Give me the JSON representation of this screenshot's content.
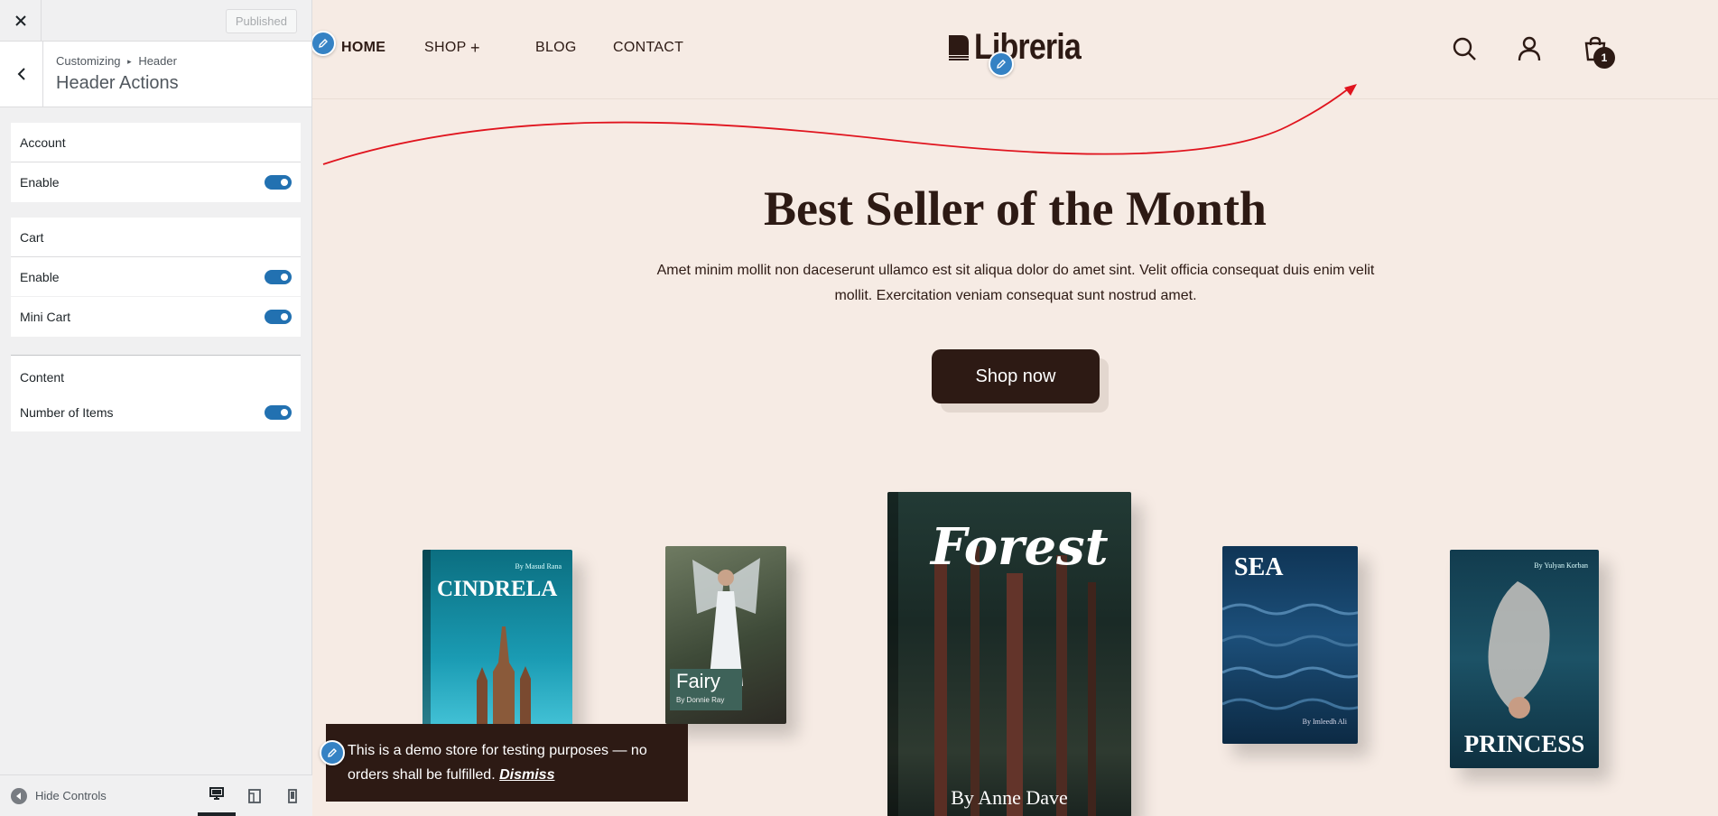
{
  "customizer": {
    "published_label": "Published",
    "breadcrumb": {
      "root": "Customizing",
      "separator": "▸",
      "parent": "Header"
    },
    "section_title": "Header Actions",
    "groups": {
      "account": {
        "title": "Account",
        "rows": [
          {
            "label": "Enable",
            "enabled": true
          }
        ]
      },
      "cart": {
        "title": "Cart",
        "rows": [
          {
            "label": "Enable",
            "enabled": true
          },
          {
            "label": "Mini Cart",
            "enabled": true
          }
        ]
      },
      "content": {
        "title": "Content",
        "rows": [
          {
            "label": "Number of Items",
            "enabled": true
          }
        ]
      }
    },
    "footer": {
      "hide_controls_label": "Hide Controls",
      "devices": [
        "desktop",
        "tablet",
        "mobile"
      ],
      "active_device": "desktop"
    },
    "toggle_color": "#2271b1"
  },
  "site": {
    "nav": {
      "home": "HOME",
      "shop": "SHOP",
      "shop_plus": "+",
      "blog": "BLOG",
      "contact": "CONTACT"
    },
    "logo_text": "Libreria",
    "cart_count": "1",
    "icons": [
      "search-icon",
      "account-icon",
      "cart-icon"
    ],
    "hero": {
      "title": "Best Seller of the Month",
      "text": "Amet minim mollit non daceserunt ullamco est sit aliqua dolor do amet sint. Velit officia consequat duis enim velit mollit. Exercitation veniam consequat sunt nostrud amet.",
      "button": "Shop now"
    },
    "books": {
      "cindrela": {
        "title": "CINDRELA",
        "author": "By Masud Rana"
      },
      "fairy": {
        "title": "Fairy",
        "author": "By Donnie Ray"
      },
      "forest": {
        "title": "Forest",
        "author": "By Anne Dave"
      },
      "sea": {
        "title": "SEA",
        "author": "By Imleedh Ali"
      },
      "princess": {
        "title": "PRINCESS",
        "author": "By Yulyan Korban"
      }
    },
    "notice": {
      "text": "This is a demo store for testing purposes — no orders shall be fulfilled.",
      "dismiss": "Dismiss"
    },
    "colors": {
      "primary": "#2d1a14",
      "background": "#f6ebe4",
      "edit_pen": "#3582c4",
      "annotation_arrow": "#e0141e"
    }
  }
}
